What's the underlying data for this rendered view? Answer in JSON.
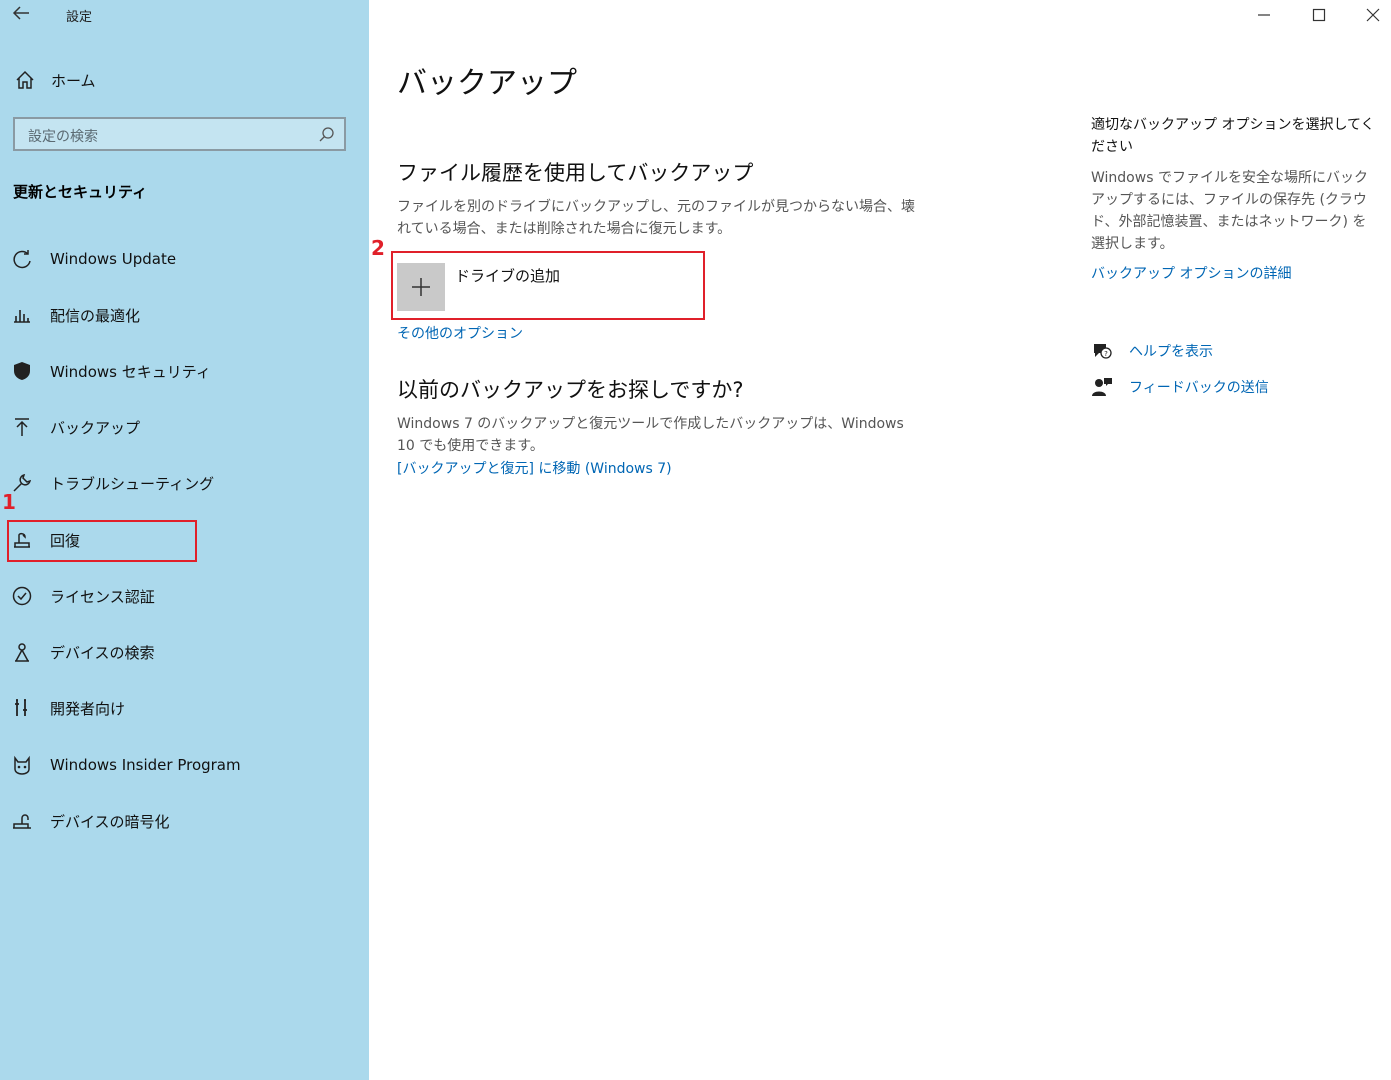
{
  "window": {
    "title": "設定",
    "back_icon": "back-arrow-icon"
  },
  "sidebar": {
    "home_label": "ホーム",
    "search_placeholder": "設定の検索",
    "section_title": "更新とセキュリティ",
    "items": [
      {
        "label": "Windows Update",
        "icon": "refresh-icon"
      },
      {
        "label": "配信の最適化",
        "icon": "delivery-optimization-icon"
      },
      {
        "label": "Windows セキュリティ",
        "icon": "shield-icon"
      },
      {
        "label": "バックアップ",
        "icon": "backup-arrow-icon"
      },
      {
        "label": "トラブルシューティング",
        "icon": "wrench-icon"
      },
      {
        "label": "回復",
        "icon": "recovery-icon"
      },
      {
        "label": "ライセンス認証",
        "icon": "check-circle-icon"
      },
      {
        "label": "デバイスの検索",
        "icon": "find-device-icon"
      },
      {
        "label": "開発者向け",
        "icon": "developer-icon"
      },
      {
        "label": "Windows Insider Program",
        "icon": "insider-cat-icon"
      },
      {
        "label": "デバイスの暗号化",
        "icon": "encryption-icon"
      }
    ]
  },
  "annotations": {
    "step1": "1",
    "step2": "2",
    "highlight_color": "#e0202a"
  },
  "main": {
    "title": "バックアップ",
    "file_history": {
      "heading": "ファイル履歴を使用してバックアップ",
      "description": "ファイルを別のドライブにバックアップし、元のファイルが見つからない場合、壊れている場合、または削除された場合に復元します。",
      "add_drive_label": "ドライブの追加",
      "more_options_link": "その他のオプション"
    },
    "older_backup": {
      "heading": "以前のバックアップをお探しですか?",
      "description": "Windows 7 のバックアップと復元ツールで作成したバックアップは、Windows 10 でも使用できます。",
      "link": "[バックアップと復元] に移動 (Windows 7)"
    }
  },
  "right_panel": {
    "heading": "適切なバックアップ オプションを選択してください",
    "description": "Windows でファイルを安全な場所にバックアップするには、ファイルの保存先 (クラウド、外部記憶装置、またはネットワーク) を選択します。",
    "details_link": "バックアップ オプションの詳細",
    "help_link": "ヘルプを表示",
    "feedback_link": "フィードバックの送信"
  },
  "colors": {
    "sidebar_bg": "#abd9ec",
    "link": "#0066b4"
  }
}
